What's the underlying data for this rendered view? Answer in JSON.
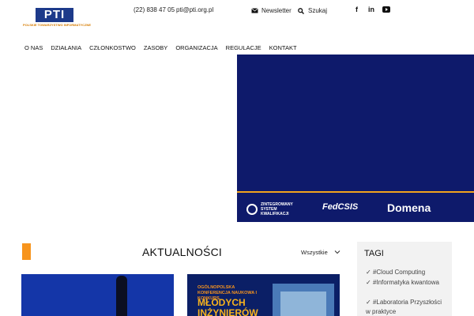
{
  "header": {
    "logo_text": "PTI",
    "logo_subtitle": "POLSKIE TOWARZYSTWO INFORMATYCZNE",
    "phone": "(22) 838 47 05",
    "email": "pti@pti.org.pl",
    "newsletter_label": "Newsletter",
    "search_label": "Szukaj",
    "social": {
      "facebook": "f",
      "linkedin": "in"
    }
  },
  "nav": {
    "items": [
      {
        "label": "O NAS"
      },
      {
        "label": "DZIAŁANIA"
      },
      {
        "label": "CZŁONKOSTWO"
      },
      {
        "label": "ZASOBY"
      },
      {
        "label": "ORGANIZACJA"
      },
      {
        "label": "REGULACJE"
      },
      {
        "label": "KONTAKT"
      }
    ]
  },
  "banner": {
    "logos": {
      "zsk_line1": "ZINTEGROWANY",
      "zsk_line2": "SYSTEM",
      "zsk_line3": "KWALIFIKACJI",
      "fedcsis": "FedCSIS",
      "domena": "Domena"
    },
    "colors": {
      "background": "#0e1a6b",
      "accent": "#f2a31d"
    }
  },
  "news": {
    "title": "AKTUALNOŚCI",
    "filter_label": "Wszystkie"
  },
  "tags": {
    "title": "TAGI",
    "items": [
      "#Cloud Computing",
      "#Informatyka kwantowa",
      "#Laboratoria Przyszłości w praktyce"
    ]
  },
  "cards": {
    "card2_subtitle": "OGÓLNOPOLSKA KONFERENCJA NAUKOWA I KONKURS",
    "card2_title_line1": "MŁODYCH",
    "card2_title_line2": "INŻYNIERÓW"
  }
}
